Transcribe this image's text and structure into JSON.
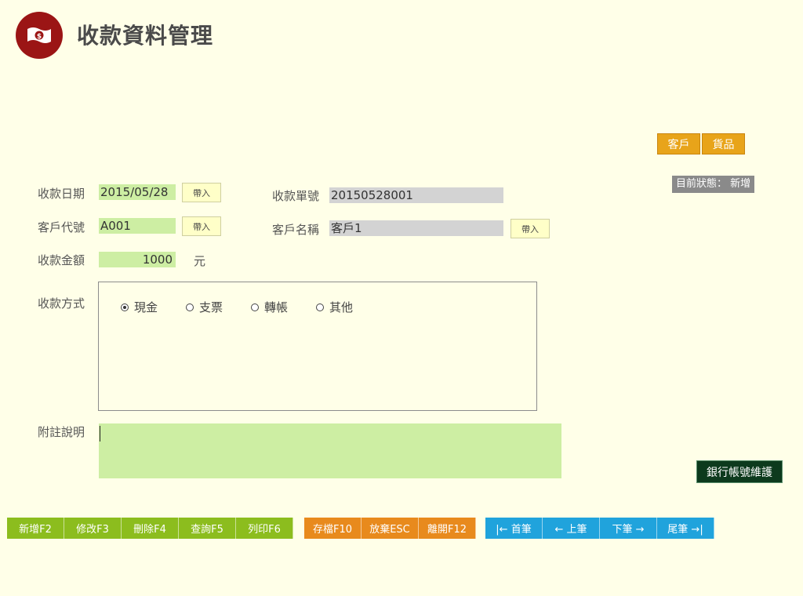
{
  "header": {
    "title": "收款資料管理",
    "logo_icon": "money-bill-icon"
  },
  "toolbar": {
    "customer_label": "客戶",
    "goods_label": "貨品"
  },
  "status": {
    "text": "目前狀態： 新增"
  },
  "form": {
    "date_label": "收款日期",
    "date_value": "2015/05/28",
    "receipt_no_label": "收款單號",
    "receipt_no_value": "20150528001",
    "customer_code_label": "客戶代號",
    "customer_code_value": "A001",
    "customer_name_label": "客戶名稱",
    "customer_name_value": "客戶1",
    "amount_label": "收款金額",
    "amount_value": "1000",
    "amount_unit": "元",
    "pick_label": "帶入",
    "method_label": "收款方式",
    "methods": [
      {
        "label": "現金",
        "selected": true
      },
      {
        "label": "支票",
        "selected": false
      },
      {
        "label": "轉帳",
        "selected": false
      },
      {
        "label": "其他",
        "selected": false
      }
    ],
    "memo_label": "附註說明",
    "memo_value": ""
  },
  "bank_button": "銀行帳號維護",
  "actions": {
    "edit_group": [
      "新增F2",
      "修改F3",
      "刪除F4",
      "查詢F5",
      "列印F6"
    ],
    "save_group": [
      "存檔F10",
      "放棄ESC",
      "離開F12"
    ],
    "nav_group": [
      "|← 首筆",
      "← 上筆",
      "下筆 →",
      "尾筆 →|"
    ]
  },
  "colors": {
    "background": "#ffffe8",
    "logo": "#9b1515",
    "input_green": "#cdeea3",
    "readonly_gray": "#d3d3d3",
    "orange": "#e8a41a",
    "green_btn": "#8cbd1e",
    "orange_btn": "#e88a1d",
    "blue_btn": "#20a3dc",
    "dark_green": "#0d3a1d"
  }
}
